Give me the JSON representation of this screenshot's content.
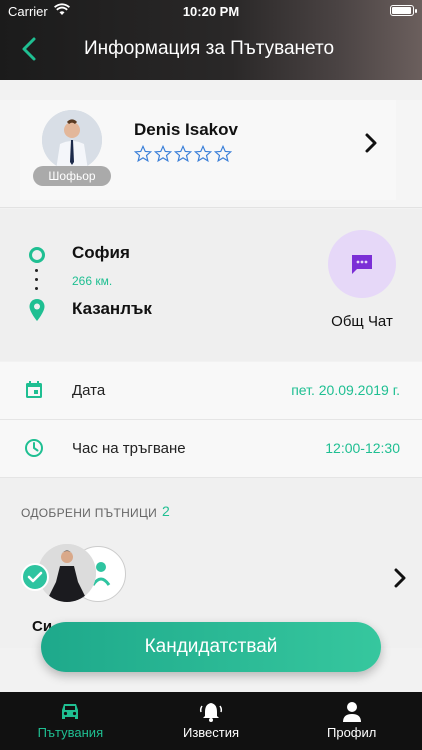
{
  "status_bar": {
    "carrier": "Carrier",
    "time": "10:20 PM",
    "battery_level": 1.0
  },
  "header": {
    "title": "Информация за Пътуването"
  },
  "driver": {
    "name": "Denis Isakov",
    "role": "Шофьор",
    "rating": 0,
    "rating_max": 5
  },
  "route": {
    "from": "София",
    "distance": "266 км.",
    "to": "Казанлък",
    "chat_label": "Общ Чат"
  },
  "info_rows": [
    {
      "label": "Дата",
      "value": "пет. 20.09.2019 г.",
      "icon": "calendar-icon"
    },
    {
      "label": "Час на тръгване",
      "value": "12:00-12:30",
      "icon": "clock-icon"
    }
  ],
  "approved": {
    "title": "ОДОБРЕНИ ПЪТНИЦИ",
    "count": "2",
    "passenger_name": "Си"
  },
  "apply_button": {
    "label": "Кандидатствай"
  },
  "tabbar": {
    "items": [
      {
        "label": "Пътувания",
        "icon": "car-icon",
        "active": true
      },
      {
        "label": "Известия",
        "icon": "bell-icon",
        "active": false
      },
      {
        "label": "Профил",
        "icon": "person-icon",
        "active": false
      }
    ]
  },
  "colors": {
    "accent": "#1fbf92",
    "chat_bg": "#e6d8f8",
    "chat_icon": "#7b2fd6",
    "star": "#3a7fd8",
    "header_bg": "#1b1b1b"
  }
}
